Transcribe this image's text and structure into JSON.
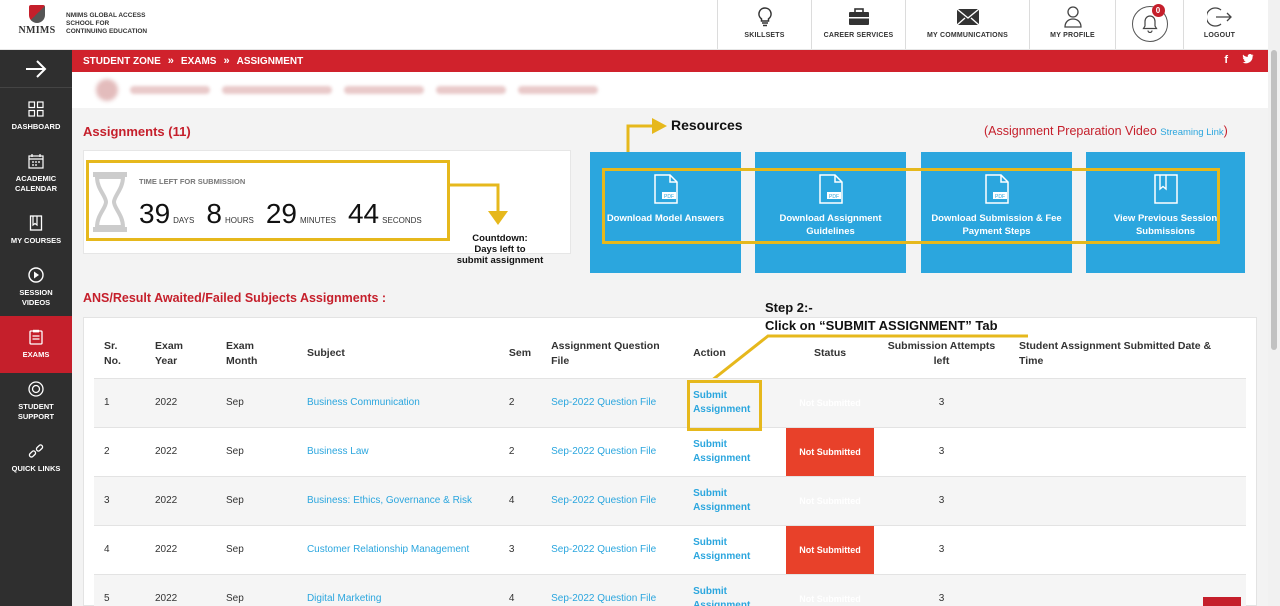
{
  "header": {
    "logo_text": "NMIMS",
    "school_lines": [
      "NMIMS GLOBAL ACCESS",
      "SCHOOL FOR",
      "CONTINUING EDUCATION"
    ],
    "nav": [
      {
        "label": "SKILLSETS",
        "icon": "lightbulb-icon"
      },
      {
        "label": "CAREER SERVICES",
        "icon": "briefcase-icon"
      },
      {
        "label": "MY COMMUNICATIONS",
        "icon": "envelope-icon"
      },
      {
        "label": "MY PROFILE",
        "icon": "user-icon"
      },
      {
        "label": "",
        "icon": "bell-icon",
        "badge": "0"
      },
      {
        "label": "LOGOUT",
        "icon": "logout-icon"
      }
    ]
  },
  "sidebar": {
    "items": [
      {
        "label": "DASHBOARD",
        "icon": "grid-icon"
      },
      {
        "label": "ACADEMIC CALENDAR",
        "icon": "calendar-icon"
      },
      {
        "label": "MY COURSES",
        "icon": "book-icon"
      },
      {
        "label": "SESSION VIDEOS",
        "icon": "play-icon"
      },
      {
        "label": "EXAMS",
        "icon": "clipboard-icon",
        "active": true
      },
      {
        "label": "STUDENT SUPPORT",
        "icon": "support-icon"
      },
      {
        "label": "QUICK LINKS",
        "icon": "link-icon"
      }
    ]
  },
  "breadcrumb": [
    "STUDENT ZONE",
    "EXAMS",
    "ASSIGNMENT"
  ],
  "social": [
    "f",
    "twitter"
  ],
  "assignments_title": "Assignments (11)",
  "video_link": {
    "prefix": "(Assignment Preparation Video",
    "link": "Streaming Link",
    "suffix": ")"
  },
  "countdown": {
    "label": "TIME LEFT FOR SUBMISSION",
    "days": "39",
    "days_unit": "DAYS",
    "hours": "8",
    "hours_unit": "HOURS",
    "minutes": "29",
    "minutes_unit": "MINUTES",
    "seconds": "44",
    "seconds_unit": "SECONDS"
  },
  "annotations": {
    "countdown": [
      "Countdown:",
      "Days left to",
      "submit assignment"
    ],
    "resources": "Resources",
    "step2_a": "Step 2:-",
    "step2_b": "Click on “SUBMIT ASSIGNMENT” Tab"
  },
  "resources": [
    "Download Model Answers",
    "Download Assignment Guidelines",
    "Download Submission & Fee Payment Steps",
    "View Previous Session Submissions"
  ],
  "section_title": "ANS/Result Awaited/Failed Subjects Assignments :",
  "table": {
    "headers": [
      "Sr. No.",
      "Exam Year",
      "Exam Month",
      "Subject",
      "Sem",
      "Assignment Question File",
      "Action",
      "Status",
      "Submission Attempts left",
      "Student Assignment Submitted Date & Time"
    ],
    "rows": [
      {
        "sr": "1",
        "year": "2022",
        "month": "Sep",
        "subject": "Business Communication",
        "sem": "2",
        "file": "Sep-2022 Question File",
        "action": "Submit Assignment",
        "status": "Not Submitted",
        "attempts": "3",
        "date": ""
      },
      {
        "sr": "2",
        "year": "2022",
        "month": "Sep",
        "subject": "Business Law",
        "sem": "2",
        "file": "Sep-2022 Question File",
        "action": "Submit Assignment",
        "status": "Not Submitted",
        "attempts": "3",
        "date": ""
      },
      {
        "sr": "3",
        "year": "2022",
        "month": "Sep",
        "subject": "Business: Ethics, Governance & Risk",
        "sem": "4",
        "file": "Sep-2022 Question File",
        "action": "Submit Assignment",
        "status": "Not Submitted",
        "attempts": "3",
        "date": ""
      },
      {
        "sr": "4",
        "year": "2022",
        "month": "Sep",
        "subject": "Customer Relationship Management",
        "sem": "3",
        "file": "Sep-2022 Question File",
        "action": "Submit Assignment",
        "status": "Not Submitted",
        "attempts": "3",
        "date": ""
      },
      {
        "sr": "5",
        "year": "2022",
        "month": "Sep",
        "subject": "Digital Marketing",
        "sem": "4",
        "file": "Sep-2022 Question File",
        "action": "Submit Assignment",
        "status": "Not Submitted",
        "attempts": "3",
        "date": ""
      }
    ]
  },
  "colors": {
    "brand_red": "#c51f2b",
    "tile_blue": "#2ba6de",
    "highlight": "#e6b81c",
    "status_red": "#e8412a"
  }
}
